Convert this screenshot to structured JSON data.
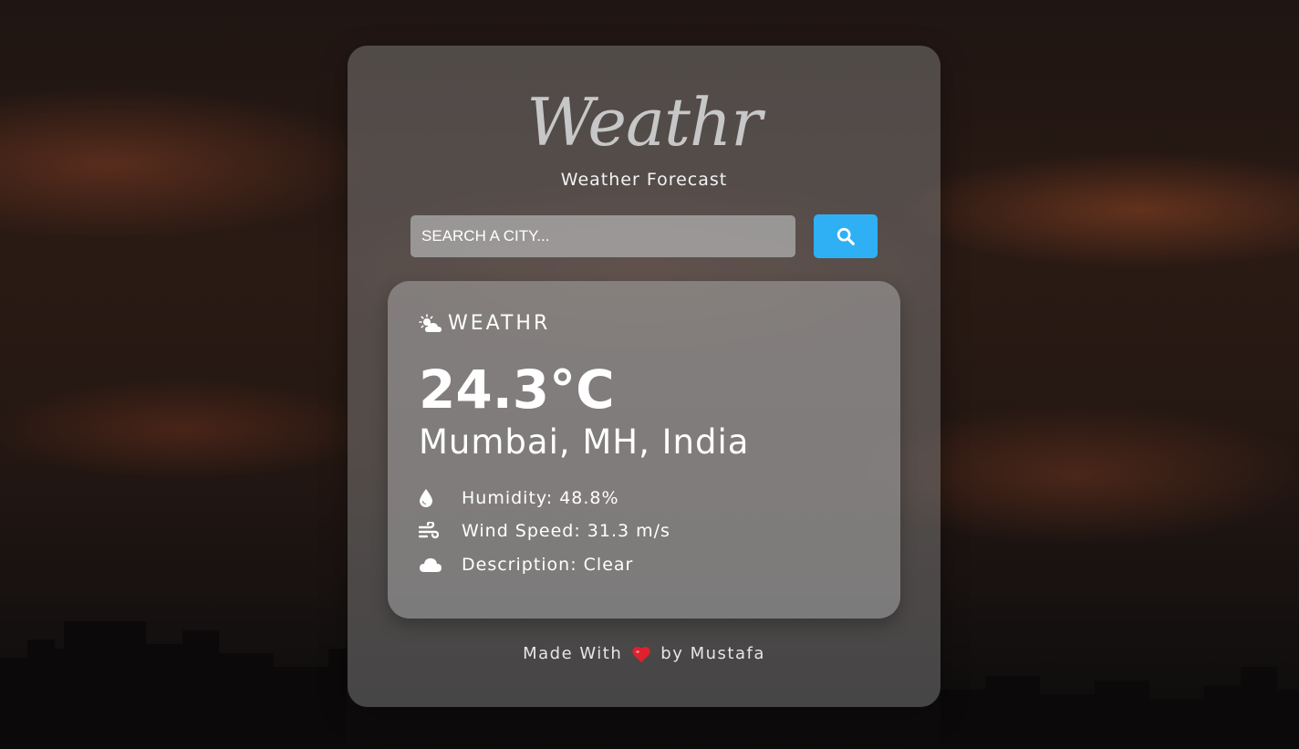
{
  "header": {
    "brand": "Weathr",
    "subtitle": "Weather Forecast"
  },
  "search": {
    "placeholder": "SEARCH A CITY..."
  },
  "card": {
    "brand": "WEATHR",
    "temperature": "24.3°C",
    "location": "Mumbai, MH, India",
    "details": [
      {
        "icon": "droplet-icon",
        "text": "Humidity: 48.8%"
      },
      {
        "icon": "wind-icon",
        "text": "Wind Speed: 31.3 m/s"
      },
      {
        "icon": "cloud-icon",
        "text": "Description: Clear"
      }
    ]
  },
  "footer": {
    "made_with": "Made With",
    "by": "by Mustafa"
  },
  "colors": {
    "accent": "#2fb0f5",
    "heart": "#e0212d"
  }
}
